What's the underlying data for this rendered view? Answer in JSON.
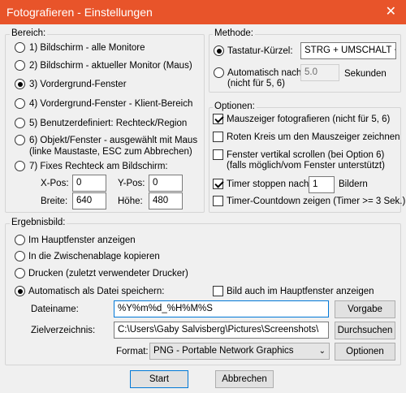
{
  "window": {
    "title": "Fotografieren - Einstellungen",
    "close": "✕"
  },
  "bereich": {
    "legend": "Bereich:",
    "options": [
      "1) Bildschirm - alle Monitore",
      "2) Bildschirm - aktueller Monitor (Maus)",
      "3) Vordergrund-Fenster",
      "4) Vordergrund-Fenster - Klient-Bereich",
      "5) Benutzerdefiniert: Rechteck/Region",
      "6) Objekt/Fenster - ausgewählt mit Maus",
      "7) Fixes Rechteck am Bildschirm:"
    ],
    "option6_sub": "(linke Maustaste, ESC zum Abbrechen)",
    "xpos_label": "X-Pos:",
    "xpos_value": "0",
    "ypos_label": "Y-Pos:",
    "ypos_value": "0",
    "breite_label": "Breite:",
    "breite_value": "640",
    "hoehe_label": "Höhe:",
    "hoehe_value": "480"
  },
  "methode": {
    "legend": "Methode:",
    "tastatur_label": "Tastatur-Kürzel:",
    "tastatur_value": "STRG + UMSCHALT +",
    "auto_label": "Automatisch nach:",
    "auto_sub": "(nicht für 5, 6)",
    "auto_value": "5.0",
    "auto_unit": "Sekunden"
  },
  "optionen": {
    "legend": "Optionen:",
    "mauszeiger": "Mauszeiger fotografieren (nicht für 5, 6)",
    "roter_kreis": "Roten Kreis um den Mauszeiger zeichnen",
    "scrollen": "Fenster vertikal scrollen (bei Option 6)",
    "scrollen_sub": "(falls möglich/vom Fenster unterstützt)",
    "timer_label": "Timer stoppen nach",
    "timer_value": "1",
    "timer_unit": "Bildern",
    "countdown": "Timer-Countdown zeigen (Timer >= 3 Sek.)"
  },
  "ergebnis": {
    "legend": "Ergebnisbild:",
    "hauptfenster": "Im Hauptfenster anzeigen",
    "zwischenablage": "In die Zwischenablage kopieren",
    "drucken": "Drucken (zuletzt verwendeter Drucker)",
    "auto_datei": "Automatisch als Datei speichern:",
    "bild_auch": "Bild auch im Hauptfenster anzeigen",
    "dateiname_label": "Dateiname:",
    "dateiname_value": "%Y%m%d_%H%M%S",
    "vorgabe": "Vorgabe",
    "ziel_label": "Zielverzeichnis:",
    "ziel_value": "C:\\Users\\Gaby Salvisberg\\Pictures\\Screenshots\\",
    "durchsuchen": "Durchsuchen",
    "format_label": "Format:",
    "format_value": "PNG - Portable Network Graphics",
    "optionen_btn": "Optionen"
  },
  "footer": {
    "start": "Start",
    "abbrechen": "Abbrechen"
  }
}
